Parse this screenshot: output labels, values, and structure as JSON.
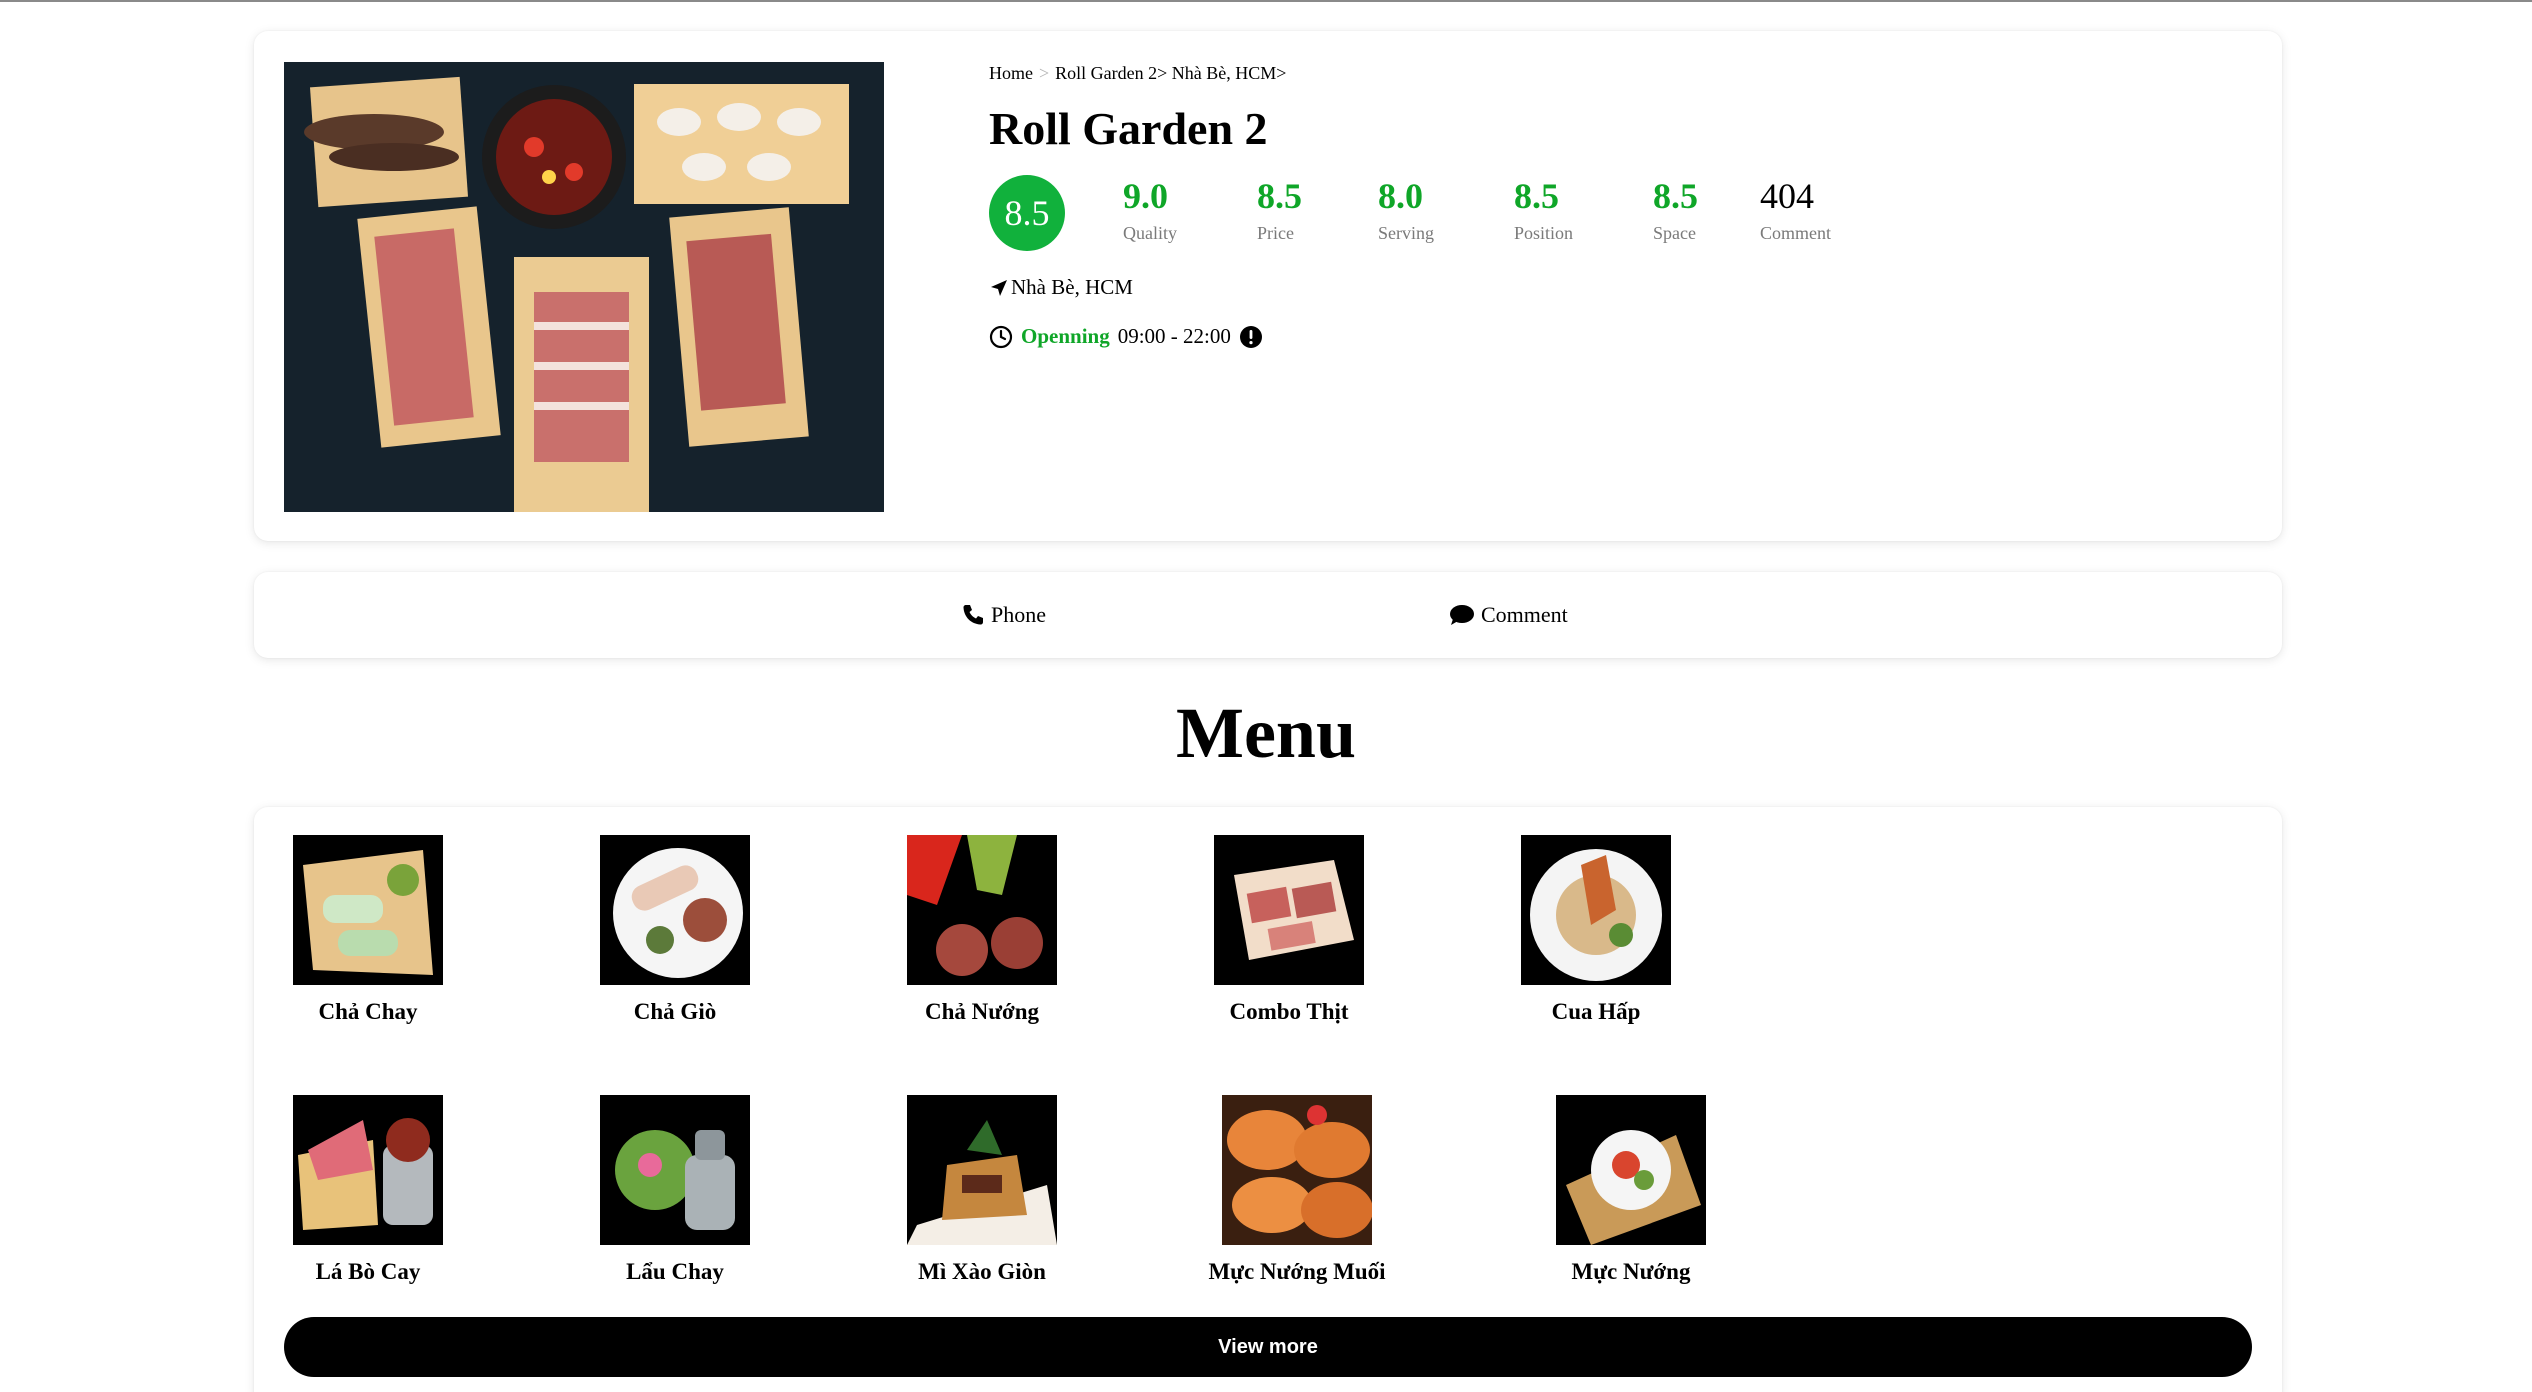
{
  "breadcrumb": {
    "home": "Home",
    "sep1": ">",
    "restaurant": "Roll Garden 2>",
    "area": "Nhà Bè, HCM>"
  },
  "restaurant": {
    "name": "Roll Garden 2",
    "overall_score": "8.5",
    "scores": [
      {
        "value": "9.0",
        "label": "Quality"
      },
      {
        "value": "8.5",
        "label": "Price"
      },
      {
        "value": "8.0",
        "label": "Serving"
      },
      {
        "value": "8.5",
        "label": "Position"
      },
      {
        "value": "8.5",
        "label": "Space"
      }
    ],
    "comment_count": "404",
    "comment_label": "Comment",
    "location": "Nhà Bè, HCM",
    "status": "Openning",
    "hours": "09:00 - 22:00"
  },
  "actions": {
    "phone": "Phone",
    "comment": "Comment"
  },
  "menu": {
    "title": "Menu",
    "items": [
      {
        "name": "Chả Chay"
      },
      {
        "name": "Chả Giò"
      },
      {
        "name": "Chả Nướng"
      },
      {
        "name": "Combo Thịt"
      },
      {
        "name": "Cua Hấp"
      },
      {
        "name": "Lá Bò Cay"
      },
      {
        "name": "Lẩu Chay"
      },
      {
        "name": "Mì Xào Giòn"
      },
      {
        "name": "Mực Nướng Muối"
      },
      {
        "name": "Mực Nướng"
      }
    ],
    "view_more": "View more"
  },
  "colors": {
    "accent_green": "#11b13c",
    "score_green": "#0fa628",
    "button": "#000000"
  }
}
